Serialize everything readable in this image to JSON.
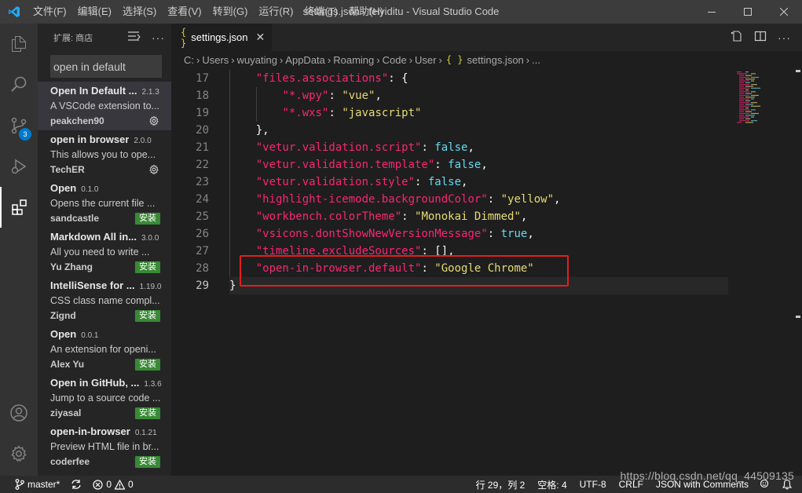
{
  "window": {
    "title": "settings.json - feiyiditu - Visual Studio Code",
    "menu": [
      "文件(F)",
      "编辑(E)",
      "选择(S)",
      "查看(V)",
      "转到(G)",
      "运行(R)",
      "终端(T)",
      "帮助(H)"
    ]
  },
  "activity_bar": {
    "scm_badge": "3"
  },
  "sidebar": {
    "title": "扩展: 商店",
    "search_value": "open in default",
    "extensions": [
      {
        "name": "Open In Default ...",
        "version": "2.1.3",
        "description": "A VSCode extension to...",
        "publisher": "peakchen90",
        "action": "gear"
      },
      {
        "name": "open in browser",
        "version": "2.0.0",
        "description": "This allows you to ope...",
        "publisher": "TechER",
        "action": "gear"
      },
      {
        "name": "Open",
        "version": "0.1.0",
        "description": "Opens the current file ...",
        "publisher": "sandcastle",
        "action": "安装"
      },
      {
        "name": "Markdown All in...",
        "version": "3.0.0",
        "description": "All you need to write ...",
        "publisher": "Yu Zhang",
        "action": "安装"
      },
      {
        "name": "IntelliSense for ...",
        "version": "1.19.0",
        "description": "CSS class name compl...",
        "publisher": "Zignd",
        "action": "安装"
      },
      {
        "name": "Open",
        "version": "0.0.1",
        "description": "An extension for openi...",
        "publisher": "Alex Yu",
        "action": "安装"
      },
      {
        "name": "Open in GitHub, ...",
        "version": "1.3.6",
        "description": "Jump to a source code ...",
        "publisher": "ziyasal",
        "action": "安装"
      },
      {
        "name": "open-in-browser",
        "version": "0.1.21",
        "description": "Preview HTML file in br...",
        "publisher": "coderfee",
        "action": "安装"
      }
    ]
  },
  "editor": {
    "tab_label": "settings.json",
    "breadcrumb": [
      "C:",
      "Users",
      "wuyating",
      "AppData",
      "Roaming",
      "Code",
      "User",
      "settings.json",
      "..."
    ],
    "lines": [
      {
        "n": "17",
        "indent": 1,
        "parts": [
          [
            "k",
            "\"files.associations\""
          ],
          [
            "p",
            ": {"
          ]
        ]
      },
      {
        "n": "18",
        "indent": 2,
        "parts": [
          [
            "k",
            "\"*.wpy\""
          ],
          [
            "p",
            ": "
          ],
          [
            "str",
            "\"vue\""
          ],
          [
            "p",
            ","
          ]
        ]
      },
      {
        "n": "19",
        "indent": 2,
        "parts": [
          [
            "k",
            "\"*.wxs\""
          ],
          [
            "p",
            ": "
          ],
          [
            "str",
            "\"javascript\""
          ]
        ]
      },
      {
        "n": "20",
        "indent": 1,
        "parts": [
          [
            "p",
            "},"
          ]
        ]
      },
      {
        "n": "21",
        "indent": 1,
        "parts": [
          [
            "k",
            "\"vetur.validation.script\""
          ],
          [
            "p",
            ": "
          ],
          [
            "kw",
            "false"
          ],
          [
            "p",
            ","
          ]
        ]
      },
      {
        "n": "22",
        "indent": 1,
        "parts": [
          [
            "k",
            "\"vetur.validation.template\""
          ],
          [
            "p",
            ": "
          ],
          [
            "kw",
            "false"
          ],
          [
            "p",
            ","
          ]
        ]
      },
      {
        "n": "23",
        "indent": 1,
        "parts": [
          [
            "k",
            "\"vetur.validation.style\""
          ],
          [
            "p",
            ": "
          ],
          [
            "kw",
            "false"
          ],
          [
            "p",
            ","
          ]
        ]
      },
      {
        "n": "24",
        "indent": 1,
        "parts": [
          [
            "k",
            "\"highlight-icemode.backgroundColor\""
          ],
          [
            "p",
            ": "
          ],
          [
            "str",
            "\"yellow\""
          ],
          [
            "p",
            ","
          ]
        ]
      },
      {
        "n": "25",
        "indent": 1,
        "parts": [
          [
            "k",
            "\"workbench.colorTheme\""
          ],
          [
            "p",
            ": "
          ],
          [
            "str",
            "\"Monokai Dimmed\""
          ],
          [
            "p",
            ","
          ]
        ]
      },
      {
        "n": "26",
        "indent": 1,
        "parts": [
          [
            "k",
            "\"vsicons.dontShowNewVersionMessage\""
          ],
          [
            "p",
            ": "
          ],
          [
            "kw",
            "true"
          ],
          [
            "p",
            ","
          ]
        ]
      },
      {
        "n": "27",
        "indent": 1,
        "parts": [
          [
            "k",
            "\"timeline.excludeSources\""
          ],
          [
            "p",
            ": [],"
          ]
        ]
      },
      {
        "n": "28",
        "indent": 1,
        "parts": [
          [
            "k",
            "\"open-in-browser.default\""
          ],
          [
            "p",
            ": "
          ],
          [
            "str",
            "\"Google Chrome\""
          ]
        ]
      },
      {
        "n": "29",
        "indent": 0,
        "parts": [
          [
            "p",
            "}"
          ]
        ],
        "current": true
      }
    ]
  },
  "statusbar": {
    "branch": "master*",
    "errors": "0",
    "warnings": "0",
    "position": "行 29，列 2",
    "spaces": "空格: 4",
    "encoding": "UTF-8",
    "eol": "CRLF",
    "language": "JSON with Comments"
  },
  "watermark": "https://blog.csdn.net/qq_44509135",
  "colors": {
    "key": "#f92672",
    "string": "#e6db74",
    "keyword": "#66d9ef",
    "install": "#388a34",
    "highlight_box": "#e02020"
  }
}
